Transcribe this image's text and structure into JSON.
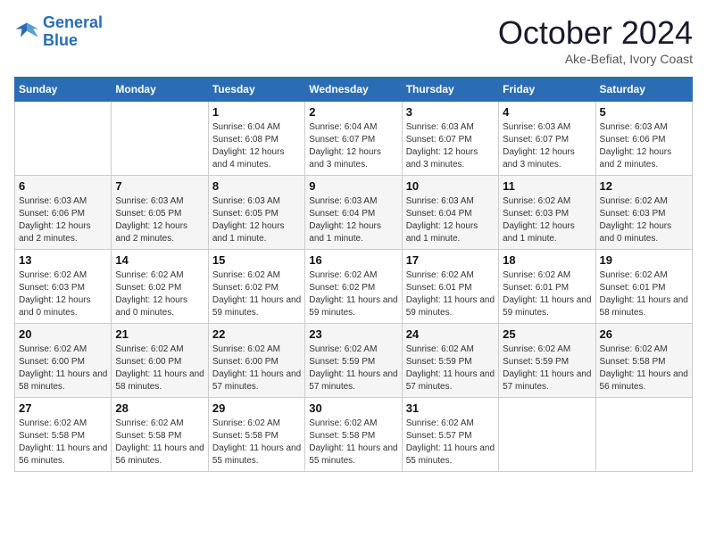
{
  "header": {
    "logo_line1": "General",
    "logo_line2": "Blue",
    "month": "October 2024",
    "location": "Ake-Befiat, Ivory Coast"
  },
  "weekdays": [
    "Sunday",
    "Monday",
    "Tuesday",
    "Wednesday",
    "Thursday",
    "Friday",
    "Saturday"
  ],
  "weeks": [
    [
      {
        "day": "",
        "info": ""
      },
      {
        "day": "",
        "info": ""
      },
      {
        "day": "1",
        "info": "Sunrise: 6:04 AM\nSunset: 6:08 PM\nDaylight: 12 hours and 4 minutes."
      },
      {
        "day": "2",
        "info": "Sunrise: 6:04 AM\nSunset: 6:07 PM\nDaylight: 12 hours and 3 minutes."
      },
      {
        "day": "3",
        "info": "Sunrise: 6:03 AM\nSunset: 6:07 PM\nDaylight: 12 hours and 3 minutes."
      },
      {
        "day": "4",
        "info": "Sunrise: 6:03 AM\nSunset: 6:07 PM\nDaylight: 12 hours and 3 minutes."
      },
      {
        "day": "5",
        "info": "Sunrise: 6:03 AM\nSunset: 6:06 PM\nDaylight: 12 hours and 2 minutes."
      }
    ],
    [
      {
        "day": "6",
        "info": "Sunrise: 6:03 AM\nSunset: 6:06 PM\nDaylight: 12 hours and 2 minutes."
      },
      {
        "day": "7",
        "info": "Sunrise: 6:03 AM\nSunset: 6:05 PM\nDaylight: 12 hours and 2 minutes."
      },
      {
        "day": "8",
        "info": "Sunrise: 6:03 AM\nSunset: 6:05 PM\nDaylight: 12 hours and 1 minute."
      },
      {
        "day": "9",
        "info": "Sunrise: 6:03 AM\nSunset: 6:04 PM\nDaylight: 12 hours and 1 minute."
      },
      {
        "day": "10",
        "info": "Sunrise: 6:03 AM\nSunset: 6:04 PM\nDaylight: 12 hours and 1 minute."
      },
      {
        "day": "11",
        "info": "Sunrise: 6:02 AM\nSunset: 6:03 PM\nDaylight: 12 hours and 1 minute."
      },
      {
        "day": "12",
        "info": "Sunrise: 6:02 AM\nSunset: 6:03 PM\nDaylight: 12 hours and 0 minutes."
      }
    ],
    [
      {
        "day": "13",
        "info": "Sunrise: 6:02 AM\nSunset: 6:03 PM\nDaylight: 12 hours and 0 minutes."
      },
      {
        "day": "14",
        "info": "Sunrise: 6:02 AM\nSunset: 6:02 PM\nDaylight: 12 hours and 0 minutes."
      },
      {
        "day": "15",
        "info": "Sunrise: 6:02 AM\nSunset: 6:02 PM\nDaylight: 11 hours and 59 minutes."
      },
      {
        "day": "16",
        "info": "Sunrise: 6:02 AM\nSunset: 6:02 PM\nDaylight: 11 hours and 59 minutes."
      },
      {
        "day": "17",
        "info": "Sunrise: 6:02 AM\nSunset: 6:01 PM\nDaylight: 11 hours and 59 minutes."
      },
      {
        "day": "18",
        "info": "Sunrise: 6:02 AM\nSunset: 6:01 PM\nDaylight: 11 hours and 59 minutes."
      },
      {
        "day": "19",
        "info": "Sunrise: 6:02 AM\nSunset: 6:01 PM\nDaylight: 11 hours and 58 minutes."
      }
    ],
    [
      {
        "day": "20",
        "info": "Sunrise: 6:02 AM\nSunset: 6:00 PM\nDaylight: 11 hours and 58 minutes."
      },
      {
        "day": "21",
        "info": "Sunrise: 6:02 AM\nSunset: 6:00 PM\nDaylight: 11 hours and 58 minutes."
      },
      {
        "day": "22",
        "info": "Sunrise: 6:02 AM\nSunset: 6:00 PM\nDaylight: 11 hours and 57 minutes."
      },
      {
        "day": "23",
        "info": "Sunrise: 6:02 AM\nSunset: 5:59 PM\nDaylight: 11 hours and 57 minutes."
      },
      {
        "day": "24",
        "info": "Sunrise: 6:02 AM\nSunset: 5:59 PM\nDaylight: 11 hours and 57 minutes."
      },
      {
        "day": "25",
        "info": "Sunrise: 6:02 AM\nSunset: 5:59 PM\nDaylight: 11 hours and 57 minutes."
      },
      {
        "day": "26",
        "info": "Sunrise: 6:02 AM\nSunset: 5:58 PM\nDaylight: 11 hours and 56 minutes."
      }
    ],
    [
      {
        "day": "27",
        "info": "Sunrise: 6:02 AM\nSunset: 5:58 PM\nDaylight: 11 hours and 56 minutes."
      },
      {
        "day": "28",
        "info": "Sunrise: 6:02 AM\nSunset: 5:58 PM\nDaylight: 11 hours and 56 minutes."
      },
      {
        "day": "29",
        "info": "Sunrise: 6:02 AM\nSunset: 5:58 PM\nDaylight: 11 hours and 55 minutes."
      },
      {
        "day": "30",
        "info": "Sunrise: 6:02 AM\nSunset: 5:58 PM\nDaylight: 11 hours and 55 minutes."
      },
      {
        "day": "31",
        "info": "Sunrise: 6:02 AM\nSunset: 5:57 PM\nDaylight: 11 hours and 55 minutes."
      },
      {
        "day": "",
        "info": ""
      },
      {
        "day": "",
        "info": ""
      }
    ]
  ]
}
